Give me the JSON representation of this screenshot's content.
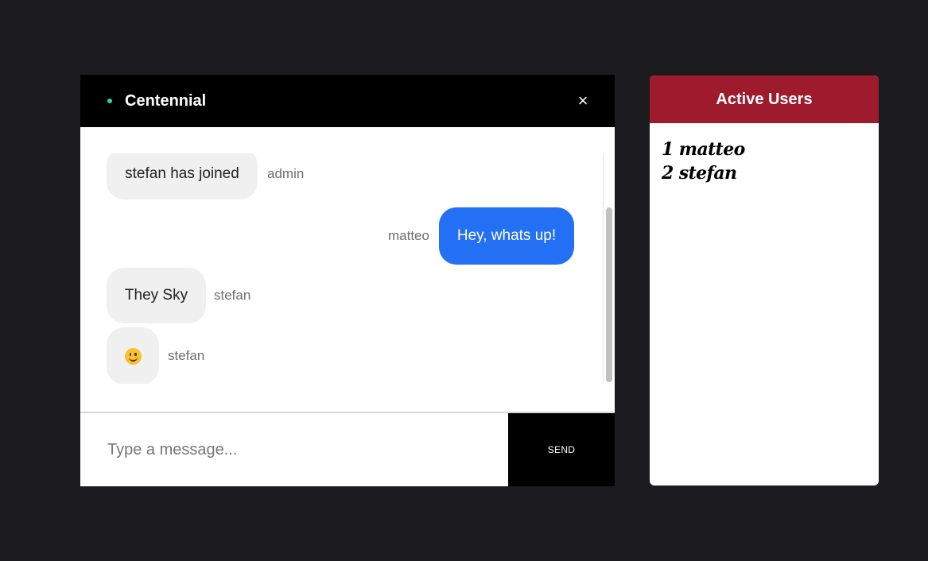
{
  "colors": {
    "online_indicator": "#3fd18a",
    "users_header_bg": "#9e1b2d",
    "outgoing_bubble": "#2370f5"
  },
  "chat": {
    "room_name": "Centennial",
    "close_label": "×",
    "messages": [
      {
        "text": "stefan has joined",
        "sender": "admin",
        "direction": "incoming"
      },
      {
        "text": "Hey, whats up!",
        "sender": "matteo",
        "direction": "outgoing"
      },
      {
        "text": "They Sky",
        "sender": "stefan",
        "direction": "incoming"
      },
      {
        "text": "",
        "icon": "slightly-smiling-face-emoji",
        "sender": "stefan",
        "direction": "incoming"
      }
    ],
    "composer": {
      "placeholder": "Type a message...",
      "value": "",
      "send_label": "SEND"
    }
  },
  "users_panel": {
    "title": "Active Users",
    "users": [
      {
        "index": "1",
        "name": "matteo"
      },
      {
        "index": "2",
        "name": "stefan"
      }
    ]
  }
}
